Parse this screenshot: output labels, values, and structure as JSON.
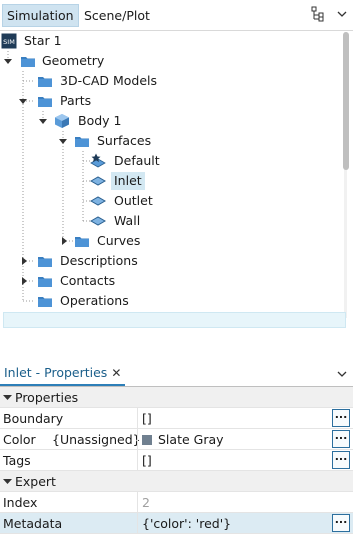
{
  "tabs": {
    "simulation": "Simulation",
    "scene_plot": "Scene/Plot"
  },
  "tree": {
    "root": {
      "icon": "sim-file-icon",
      "icon_text": "SIM",
      "label": "Star 1"
    },
    "geometry": {
      "label": "Geometry"
    },
    "cad_models": {
      "label": "3D-CAD Models"
    },
    "parts": {
      "label": "Parts"
    },
    "body1": {
      "label": "Body 1"
    },
    "surfaces": {
      "label": "Surfaces"
    },
    "default": {
      "label": "Default"
    },
    "inlet": {
      "label": "Inlet"
    },
    "outlet": {
      "label": "Outlet"
    },
    "wall": {
      "label": "Wall"
    },
    "curves": {
      "label": "Curves"
    },
    "descriptions": {
      "label": "Descriptions"
    },
    "contacts": {
      "label": "Contacts"
    },
    "operations": {
      "label": "Operations"
    }
  },
  "properties": {
    "tab_title": "Inlet - Properties",
    "close_glyph": "✕",
    "section_properties": "Properties",
    "boundary": {
      "name": "Boundary",
      "value": "[]"
    },
    "color": {
      "name": "Color",
      "extra": "{Unassigned}",
      "value": "Slate Gray",
      "swatch": "#708090"
    },
    "tags": {
      "name": "Tags",
      "value": "[]"
    },
    "section_expert": "Expert",
    "index": {
      "name": "Index",
      "value": "2"
    },
    "metadata": {
      "name": "Metadata",
      "value": "{'color': 'red'}"
    },
    "ellipsis": "..."
  },
  "colors": {
    "accent": "#2d7fb8",
    "selection": "#d3e8f2",
    "folder": "#3a7fc1"
  }
}
